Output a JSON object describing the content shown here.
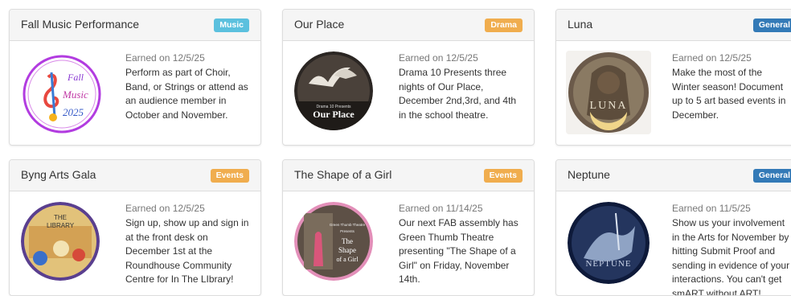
{
  "colors": {
    "music": "#5bc0de",
    "drama": "#f0ad4e",
    "general": "#337ab7",
    "events": "#f0ad4e"
  },
  "cards": [
    {
      "title": "Fall Music Performance",
      "badge": "Music",
      "earned": "Earned on 12/5/25",
      "desc": "Perform as part of Choir, Band, or Strings or attend as an audience member in October and November.",
      "image_text": [
        "Fall",
        "Music",
        "2025"
      ]
    },
    {
      "title": "Our Place",
      "badge": "Drama",
      "earned": "Earned on 12/5/25",
      "desc": "Drama 10 Presents three nights of Our Place, December 2nd,3rd, and 4th in the school theatre.",
      "image_text": [
        "Drama 10 Presents",
        "Our Place"
      ]
    },
    {
      "title": "Luna",
      "badge": "General",
      "earned": "Earned on 12/5/25",
      "desc": "Make the most of the Winter season! Document up to 5 art based events in December.",
      "image_text": [
        "LUNA"
      ]
    },
    {
      "title": "Byng Arts Gala",
      "badge": "Events",
      "earned": "Earned on 12/5/25",
      "desc": "Sign up, show up and sign in at the front desk on December 1st at the Roundhouse Community Centre for In The LIbrary!",
      "image_text": [
        "THE",
        "LIBRARY"
      ]
    },
    {
      "title": "The Shape of a Girl",
      "badge": "Events",
      "earned": "Earned on 11/14/25",
      "desc": "Our next FAB assembly has Green Thumb Theatre presenting \"The Shape of a Girl\" on Friday, November 14th.",
      "image_text": [
        "Green Thumb Theatre",
        "Presents",
        "The",
        "Shape",
        "of a Girl"
      ]
    },
    {
      "title": "Neptune",
      "badge": "General",
      "earned": "Earned on 11/5/25",
      "desc": "Show us your involvement in the Arts for November by hitting Submit Proof and sending in evidence of your interactions. You can't get smART without ART!",
      "image_text": [
        "NEPTUNE"
      ]
    }
  ]
}
